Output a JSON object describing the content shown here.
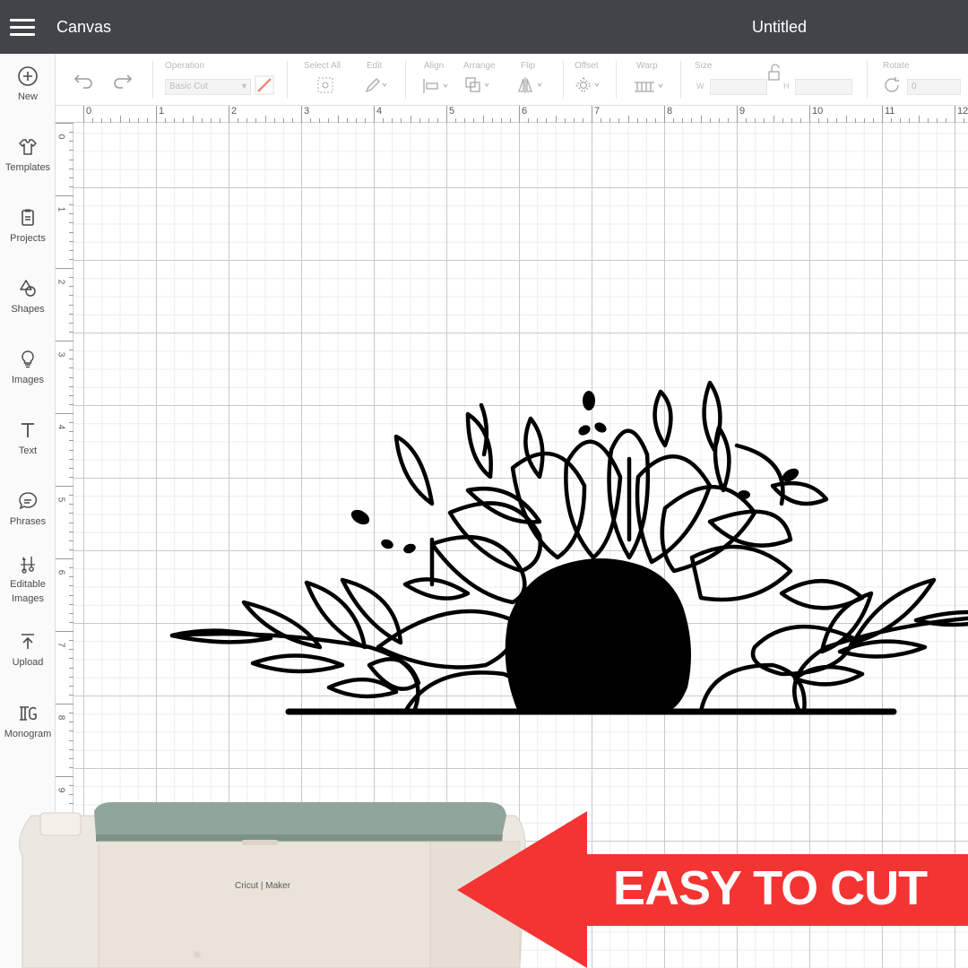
{
  "header": {
    "app_title": "Canvas",
    "document_title": "Untitled"
  },
  "sidebar": {
    "items": [
      {
        "label": "New",
        "icon": "plus-circle-icon"
      },
      {
        "label": "Templates",
        "icon": "shirt-icon"
      },
      {
        "label": "Projects",
        "icon": "clipboard-icon"
      },
      {
        "label": "Shapes",
        "icon": "shapes-icon"
      },
      {
        "label": "Images",
        "icon": "lightbulb-icon"
      },
      {
        "label": "Text",
        "icon": "text-t-icon"
      },
      {
        "label": "Phrases",
        "icon": "speech-bubble-icon"
      },
      {
        "label": "Editable",
        "icon": "editable-image-icon"
      },
      {
        "label": "Images",
        "icon": ""
      },
      {
        "label": "Upload",
        "icon": "upload-arrow-icon"
      },
      {
        "label": "Monogram",
        "icon": "monogram-icon"
      }
    ]
  },
  "toolbar": {
    "operation_label": "Operation",
    "operation_value": "Basic Cut",
    "select_all_label": "Select All",
    "edit_label": "Edit",
    "align_label": "Align",
    "arrange_label": "Arrange",
    "flip_label": "Flip",
    "offset_label": "Offset",
    "warp_label": "Warp",
    "size_label": "Size",
    "size_w_label": "W",
    "size_h_label": "H",
    "rotate_label": "Rotate",
    "rotate_value": "0"
  },
  "rulers": {
    "horizontal": [
      "0",
      "1",
      "2",
      "3",
      "4",
      "5",
      "6",
      "7",
      "8",
      "9",
      "10",
      "11",
      "12"
    ],
    "vertical": [
      "0",
      "1",
      "2",
      "3",
      "4",
      "5",
      "6",
      "7",
      "8",
      "9"
    ]
  },
  "machine": {
    "brand_text": "Cricut | Maker"
  },
  "banner": {
    "text": "EASY TO CUT",
    "color": "#f43433"
  },
  "colors": {
    "header_bg": "#414549",
    "sidebar_bg": "#fafafa",
    "grid_major": "#c9c9c9",
    "grid_minor": "#ececec",
    "machine_lid": "#8fa69a",
    "machine_body": "#ece7e0"
  }
}
